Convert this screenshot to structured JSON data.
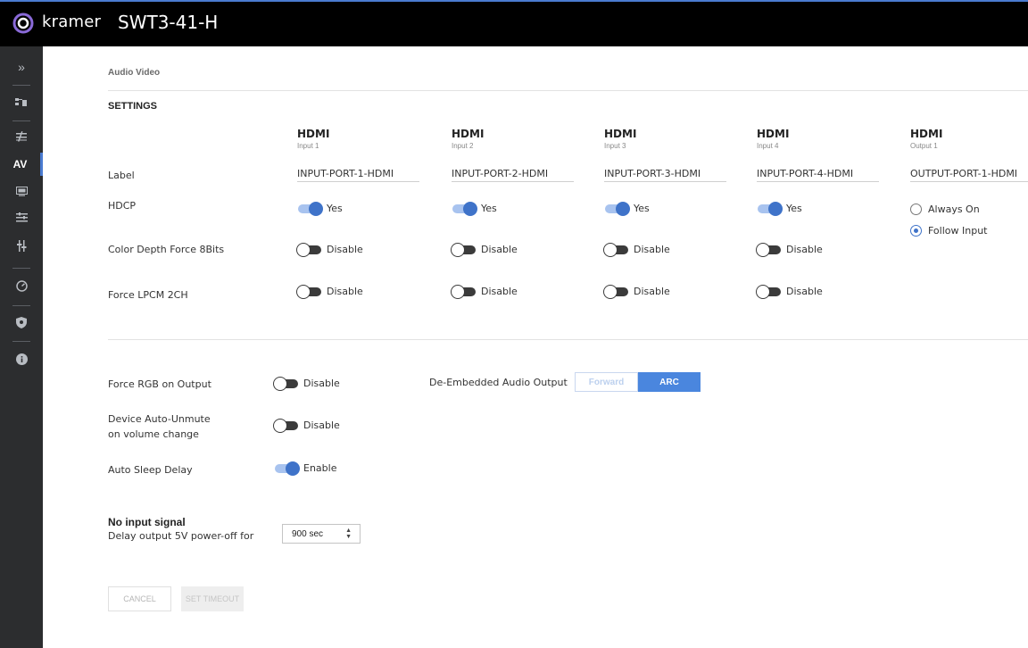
{
  "header": {
    "brand": "kramer",
    "device": "SWT3-41-H"
  },
  "sidebar": {
    "items": [
      {
        "icon": "expand-icon",
        "label": "»"
      },
      {
        "icon": "network-icon",
        "label": ""
      },
      {
        "icon": "auto-switch-icon",
        "label": ""
      },
      {
        "icon": "av-icon",
        "label": "AV",
        "active": true
      },
      {
        "icon": "display-icon",
        "label": ""
      },
      {
        "icon": "settings-sliders-icon",
        "label": ""
      },
      {
        "icon": "audio-mixer-icon",
        "label": ""
      },
      {
        "icon": "diagnostics-icon",
        "label": ""
      },
      {
        "icon": "security-shield-icon",
        "label": ""
      },
      {
        "icon": "info-icon",
        "label": ""
      }
    ]
  },
  "breadcrumb": "Audio Video",
  "settings_title": "SETTINGS",
  "row_labels": {
    "label": "Label",
    "hdcp": "HDCP",
    "color_depth": "Color Depth Force 8Bits",
    "force_lpcm": "Force LPCM 2CH"
  },
  "ports": [
    {
      "type": "HDMI",
      "sub": "Input 1",
      "label": "INPUT-PORT-1-HDMI",
      "hdcp": "Yes",
      "color_depth": "Disable",
      "force_lpcm": "Disable"
    },
    {
      "type": "HDMI",
      "sub": "Input 2",
      "label": "INPUT-PORT-2-HDMI",
      "hdcp": "Yes",
      "color_depth": "Disable",
      "force_lpcm": "Disable"
    },
    {
      "type": "HDMI",
      "sub": "Input 3",
      "label": "INPUT-PORT-3-HDMI",
      "hdcp": "Yes",
      "color_depth": "Disable",
      "force_lpcm": "Disable"
    },
    {
      "type": "HDMI",
      "sub": "Input 4",
      "label": "INPUT-PORT-4-HDMI",
      "hdcp": "Yes",
      "color_depth": "Disable",
      "force_lpcm": "Disable"
    }
  ],
  "output": {
    "type": "HDMI",
    "sub": "Output 1",
    "label": "OUTPUT-PORT-1-HDMI",
    "hdcp_options": [
      "Always On",
      "Follow Input"
    ],
    "hdcp_selected": "Follow Input"
  },
  "general": {
    "force_rgb_label": "Force RGB on Output",
    "force_rgb_value": "Disable",
    "auto_unmute_label_1": "Device Auto-Unmute",
    "auto_unmute_label_2": "on volume change",
    "auto_unmute_value": "Disable",
    "auto_sleep_label": "Auto Sleep Delay",
    "auto_sleep_value": "Enable",
    "deembedded_label": "De-Embedded Audio Output",
    "deembedded_options": [
      "Forward",
      "ARC"
    ],
    "deembedded_selected": "ARC"
  },
  "no_input": {
    "title": "No input signal",
    "delay_label": "Delay output 5V power-off for",
    "delay_value": "900 sec"
  },
  "buttons": {
    "cancel": "CANCEL",
    "set_timeout": "SET TIMEOUT"
  },
  "colors": {
    "accent": "#3f73c9",
    "topbar": "#000000",
    "sidebar": "#2c2d2f"
  }
}
